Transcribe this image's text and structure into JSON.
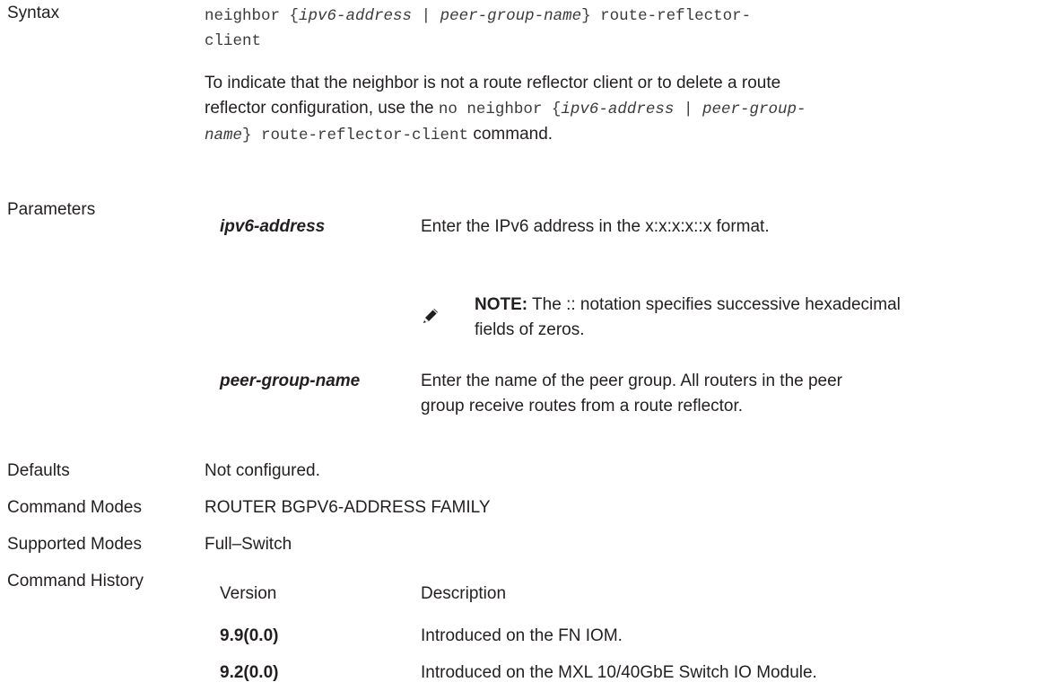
{
  "syntax": {
    "label": "Syntax",
    "cmd_l1_a": "neighbor {",
    "cmd_l1_b": "ipv6-address",
    "cmd_l1_c": " | ",
    "cmd_l1_d": "peer-group-name",
    "cmd_l1_e": "} route-reflector-",
    "cmd_l2": "client",
    "desc_l1": "To indicate that the neighbor is not a route reflector client or to delete a route",
    "desc_l2_a": "reflector configuration, use the ",
    "desc_l2_b": "no neighbor {",
    "desc_l2_c": "ipv6-address",
    "desc_l2_d": " | ",
    "desc_l2_e": "peer-group-",
    "desc_l3_a": "name",
    "desc_l3_b": "} route-reflector-client",
    "desc_l3_c": " command."
  },
  "parameters": {
    "label": "Parameters",
    "items": [
      {
        "name": "ipv6-address",
        "desc": "Enter the IPv6 address in the x:x:x:x::x format."
      },
      {
        "name": "peer-group-name",
        "desc_l1": "Enter the name of the peer group. All routers in the peer",
        "desc_l2": "group receive routes from a route reflector."
      }
    ],
    "note": {
      "label": "NOTE:",
      "text_l1": " The :: notation specifies successive hexadecimal",
      "text_l2": "fields of zeros."
    }
  },
  "defaults": {
    "label": "Defaults",
    "value": "Not configured."
  },
  "command_modes": {
    "label": "Command Modes",
    "value": "ROUTER BGPV6-ADDRESS FAMILY"
  },
  "supported_modes": {
    "label": "Supported Modes",
    "value": "Full–Switch"
  },
  "command_history": {
    "label": "Command History",
    "headers": [
      "Version",
      "Description"
    ],
    "rows": [
      {
        "version": "9.9(0.0)",
        "description": "Introduced on the FN IOM."
      },
      {
        "version": "9.2(0.0)",
        "description": "Introduced on the MXL 10/40GbE Switch IO Module."
      }
    ]
  },
  "colors": {
    "text": "#231f20",
    "mono": "#3b3b3b"
  }
}
